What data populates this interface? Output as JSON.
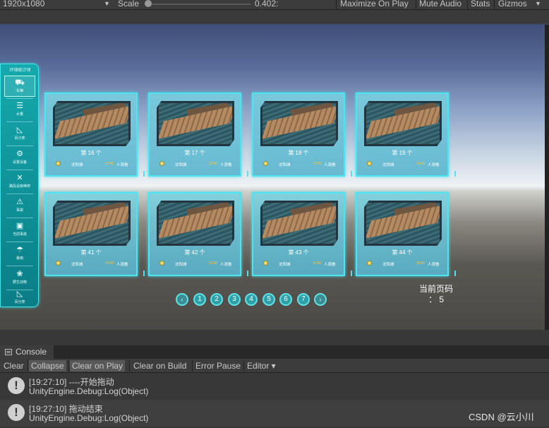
{
  "game_toolbar": {
    "resolution": "1920x1080",
    "scale_label": "Scale",
    "scale_value": "0.402:",
    "scale_fraction": 0.0,
    "buttons": [
      "Maximize On Play",
      "Mute Audio",
      "Stats",
      "Gizmos"
    ]
  },
  "sidebar": {
    "title": "环境统计项",
    "items": [
      {
        "label": "车辆",
        "icon": "car-icon"
      },
      {
        "label": "水量",
        "icon": "lines-icon"
      },
      {
        "label": "百分表",
        "icon": "ruler-icon"
      },
      {
        "label": "设置设备",
        "icon": "gear-icon"
      },
      {
        "label": "路段设施维修",
        "icon": "tools-icon"
      },
      {
        "label": "事故",
        "icon": "warning-icon"
      },
      {
        "label": "当前事故",
        "icon": "calendar-icon"
      },
      {
        "label": "暴雨",
        "icon": "rain-icon"
      },
      {
        "label": "野生动物",
        "icon": "animal-icon"
      },
      {
        "label": "百分表",
        "icon": "ruler-icon"
      }
    ]
  },
  "cards": [
    {
      "title": "第 16 个",
      "city": "沈阳城",
      "count": "3240",
      "unit": "人观看"
    },
    {
      "title": "第 17 个",
      "city": "沈阳城",
      "count": "3240",
      "unit": "人观看"
    },
    {
      "title": "第 18 个",
      "city": "沈阳城",
      "count": "3240",
      "unit": "人观看"
    },
    {
      "title": "第 19 个",
      "city": "沈阳城",
      "count": "3240",
      "unit": "人观看"
    },
    {
      "title": "第 41 个",
      "city": "沈阳城",
      "count": "3240",
      "unit": "人观看"
    },
    {
      "title": "第 42 个",
      "city": "沈阳城",
      "count": "3240",
      "unit": "人观看"
    },
    {
      "title": "第 43 个",
      "city": "沈阳城",
      "count": "3240",
      "unit": "人观看"
    },
    {
      "title": "第 44 个",
      "city": "沈阳城",
      "count": "3240",
      "unit": "人观看"
    }
  ],
  "pager": {
    "prev": "‹",
    "next": "›",
    "pages": [
      "1",
      "2",
      "3",
      "4",
      "5",
      "6",
      "7"
    ],
    "current_label_line1": "当前页码",
    "current_label_line2": "： 5"
  },
  "console": {
    "tab_label": "Console",
    "toolbar": [
      "Clear",
      "Collapse",
      "Clear on Play",
      "Clear on Build",
      "Error Pause",
      "Editor ▾"
    ],
    "entries": [
      {
        "line1": "[19:27:10] ----开始拖动",
        "line2": "UnityEngine.Debug:Log(Object)"
      },
      {
        "line1": "[19:27:10] 拖动结束",
        "line2": "UnityEngine.Debug:Log(Object)"
      }
    ]
  },
  "watermark": "CSDN @云小川"
}
